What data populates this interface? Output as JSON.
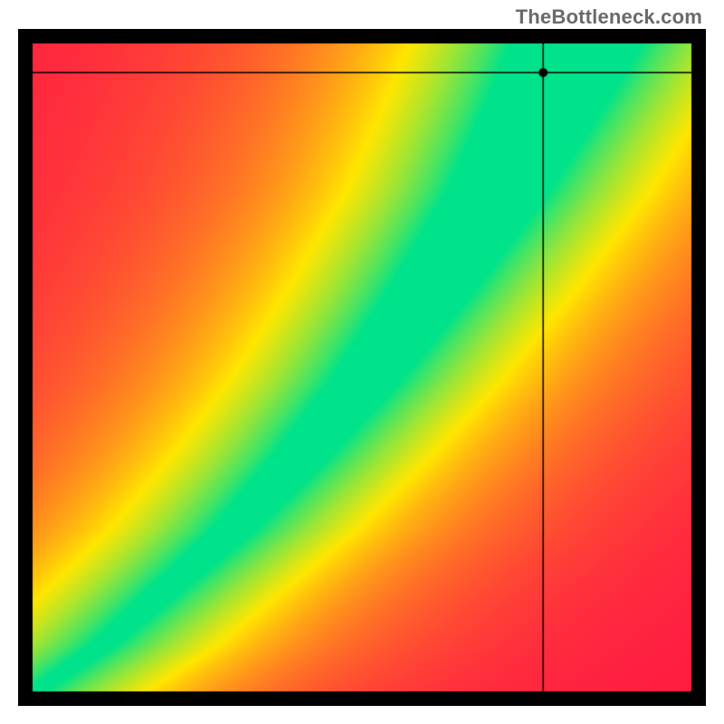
{
  "watermark": "TheBottleneck.com",
  "chart_data": {
    "type": "heatmap",
    "title": "",
    "xlabel": "",
    "ylabel": "",
    "xlim": [
      0,
      1
    ],
    "ylim": [
      0,
      1
    ],
    "ridge_points": [
      {
        "x": 0.0,
        "y": 0.0
      },
      {
        "x": 0.1,
        "y": 0.07
      },
      {
        "x": 0.2,
        "y": 0.16
      },
      {
        "x": 0.3,
        "y": 0.25
      },
      {
        "x": 0.4,
        "y": 0.36
      },
      {
        "x": 0.5,
        "y": 0.48
      },
      {
        "x": 0.6,
        "y": 0.62
      },
      {
        "x": 0.7,
        "y": 0.77
      },
      {
        "x": 0.78,
        "y": 0.92
      },
      {
        "x": 0.82,
        "y": 1.0
      }
    ],
    "ridge_half_width_vs_y": [
      {
        "y": 0.0,
        "w": 0.01
      },
      {
        "y": 0.2,
        "w": 0.025
      },
      {
        "y": 0.5,
        "w": 0.05
      },
      {
        "y": 0.8,
        "w": 0.075
      },
      {
        "y": 1.0,
        "w": 0.095
      }
    ],
    "marker": {
      "x": 0.775,
      "y": 0.955
    },
    "crosshair": {
      "x": 0.775,
      "y": 0.955
    },
    "colormap_stops": [
      {
        "t": 0.0,
        "color": "#ff1744"
      },
      {
        "t": 0.5,
        "color": "#ffe600"
      },
      {
        "t": 1.0,
        "color": "#00e38a"
      }
    ],
    "background_score_range": [
      0,
      1
    ],
    "border_px": 16
  }
}
